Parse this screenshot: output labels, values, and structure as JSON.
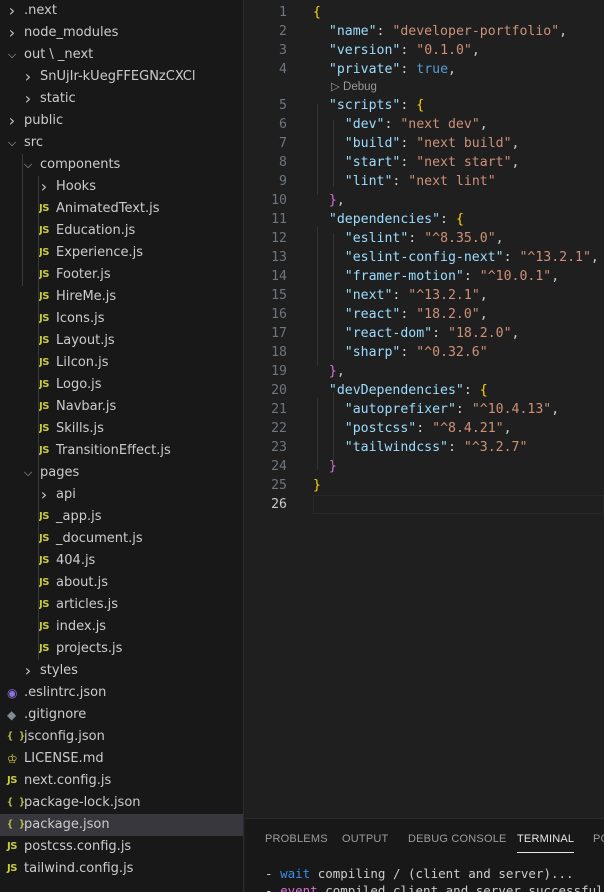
{
  "explorer": {
    "items": [
      {
        "label": ".next",
        "kind": "folder",
        "open": false
      },
      {
        "label": "node_modules",
        "kind": "folder",
        "open": false
      },
      {
        "label": "out \\ _next",
        "kind": "folder",
        "open": true
      },
      {
        "label": "SnUjIr-kUegFFEGNzCXCl",
        "kind": "folder",
        "open": false
      },
      {
        "label": "static",
        "kind": "folder",
        "open": false
      },
      {
        "label": "public",
        "kind": "folder",
        "open": false
      },
      {
        "label": "src",
        "kind": "folder",
        "open": true
      },
      {
        "label": "components",
        "kind": "folder",
        "open": true
      },
      {
        "label": "Hooks",
        "kind": "folder",
        "open": false
      },
      {
        "label": "AnimatedText.js",
        "kind": "js"
      },
      {
        "label": "Education.js",
        "kind": "js"
      },
      {
        "label": "Experience.js",
        "kind": "js"
      },
      {
        "label": "Footer.js",
        "kind": "js"
      },
      {
        "label": "HireMe.js",
        "kind": "js"
      },
      {
        "label": "Icons.js",
        "kind": "js"
      },
      {
        "label": "Layout.js",
        "kind": "js"
      },
      {
        "label": "LiIcon.js",
        "kind": "js"
      },
      {
        "label": "Logo.js",
        "kind": "js"
      },
      {
        "label": "Navbar.js",
        "kind": "js"
      },
      {
        "label": "Skills.js",
        "kind": "js"
      },
      {
        "label": "TransitionEffect.js",
        "kind": "js"
      },
      {
        "label": "pages",
        "kind": "folder",
        "open": true
      },
      {
        "label": "api",
        "kind": "folder",
        "open": false
      },
      {
        "label": "_app.js",
        "kind": "js"
      },
      {
        "label": "_document.js",
        "kind": "js"
      },
      {
        "label": "404.js",
        "kind": "js"
      },
      {
        "label": "about.js",
        "kind": "js"
      },
      {
        "label": "articles.js",
        "kind": "js"
      },
      {
        "label": "index.js",
        "kind": "js"
      },
      {
        "label": "projects.js",
        "kind": "js"
      },
      {
        "label": "styles",
        "kind": "folder",
        "open": false
      },
      {
        "label": ".eslintrc.json",
        "kind": "eslint"
      },
      {
        "label": ".gitignore",
        "kind": "git"
      },
      {
        "label": "jsconfig.json",
        "kind": "json"
      },
      {
        "label": "LICENSE.md",
        "kind": "license"
      },
      {
        "label": "next.config.js",
        "kind": "js"
      },
      {
        "label": "package-lock.json",
        "kind": "json"
      },
      {
        "label": "package.json",
        "kind": "json",
        "selected": true
      },
      {
        "label": "postcss.config.js",
        "kind": "js"
      },
      {
        "label": "tailwind.config.js",
        "kind": "js"
      }
    ]
  },
  "icons": {
    "folder_closed": "chevron-right-icon",
    "folder_open": "chevron-down-icon",
    "js": "JS",
    "json": "{ }",
    "git": "◆",
    "license": "♔",
    "eslint": "◉"
  },
  "editor": {
    "active_line": 26,
    "codelens": "Debug",
    "lines": [
      "{",
      "  \"name\": \"developer-portfolio\",",
      "  \"version\": \"0.1.0\",",
      "  \"private\": true,",
      "  \"scripts\": {",
      "    \"dev\": \"next dev\",",
      "    \"build\": \"next build\",",
      "    \"start\": \"next start\",",
      "    \"lint\": \"next lint\"",
      "  },",
      "  \"dependencies\": {",
      "    \"eslint\": \"^8.35.0\",",
      "    \"eslint-config-next\": \"^13.2.1\",",
      "    \"framer-motion\": \"^10.0.1\",",
      "    \"next\": \"^13.2.1\",",
      "    \"react\": \"18.2.0\",",
      "    \"react-dom\": \"18.2.0\",",
      "    \"sharp\": \"^0.32.6\"",
      "  },",
      "  \"devDependencies\": {",
      "    \"autoprefixer\": \"^10.4.13\",",
      "    \"postcss\": \"^8.4.21\",",
      "    \"tailwindcss\": \"^3.2.7\"",
      "  }",
      "}",
      ""
    ]
  },
  "panel": {
    "tabs": [
      "PROBLEMS",
      "OUTPUT",
      "DEBUG CONSOLE",
      "TERMINAL",
      "PORTS"
    ],
    "active_tab": "TERMINAL",
    "terminal_lines": [
      {
        "prefix": "- ",
        "keyword": "wait",
        "rest": " compiling / (client and server)..."
      },
      {
        "prefix": "- ",
        "keyword": "event",
        "rest": " compiled client and server successfully"
      }
    ]
  },
  "colors": {
    "sidebar_bg": "#181818",
    "editor_bg": "#1f1f1f",
    "selection": "#37373d",
    "json_key": "#9cdcfe",
    "json_string": "#ce9178",
    "json_bool": "#569cd6",
    "bracket_level1": "#ffd700",
    "bracket_level2": "#da70d6"
  }
}
